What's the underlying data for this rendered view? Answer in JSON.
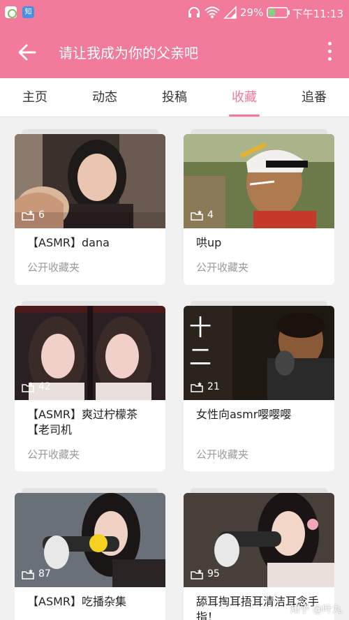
{
  "status": {
    "battery": "29%",
    "time": "下午11:13",
    "app_badge": "知"
  },
  "appbar": {
    "title": "请让我成为你的父亲吧"
  },
  "tabs": [
    {
      "label": "主页",
      "active": false
    },
    {
      "label": "动态",
      "active": false
    },
    {
      "label": "投稿",
      "active": false
    },
    {
      "label": "收藏",
      "active": true
    },
    {
      "label": "追番",
      "active": false
    }
  ],
  "folders": [
    {
      "name": "【ASMR】dana",
      "count": "6",
      "visibility": "公开收藏夹"
    },
    {
      "name": "哄up",
      "count": "4",
      "visibility": "公开收藏夹"
    },
    {
      "name": "【ASMR】爽过柠檬茶【老司机",
      "count": "42",
      "visibility": "公开收藏夹"
    },
    {
      "name": "女性向asmr嘤嘤嘤",
      "count": "21",
      "visibility": "公开收藏夹"
    },
    {
      "name": "【ASMR】吃播杂集",
      "count": "87",
      "visibility": ""
    },
    {
      "name": "舔耳掏耳捂耳清洁耳念手指！",
      "count": "95",
      "visibility": ""
    }
  ],
  "watermark": "知乎 @叶九",
  "colors": {
    "accent": "#f27a9b"
  }
}
